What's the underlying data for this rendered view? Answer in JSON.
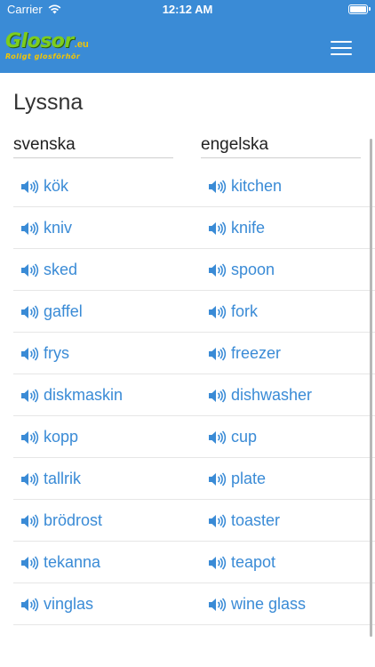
{
  "status": {
    "carrier": "Carrier",
    "time": "12:12 AM"
  },
  "header": {
    "logo_main": "Glosor",
    "logo_tld": ".eu",
    "logo_tagline": "Roligt glosförhör"
  },
  "page": {
    "title": "Lyssna"
  },
  "columns": {
    "left": "svenska",
    "right": "engelska"
  },
  "words": [
    {
      "sv": "kök",
      "en": "kitchen"
    },
    {
      "sv": "kniv",
      "en": "knife"
    },
    {
      "sv": "sked",
      "en": "spoon"
    },
    {
      "sv": "gaffel",
      "en": "fork"
    },
    {
      "sv": "frys",
      "en": "freezer"
    },
    {
      "sv": "diskmaskin",
      "en": "dishwasher"
    },
    {
      "sv": "kopp",
      "en": "cup"
    },
    {
      "sv": "tallrik",
      "en": "plate"
    },
    {
      "sv": "brödrost",
      "en": "toaster"
    },
    {
      "sv": "tekanna",
      "en": "teapot"
    },
    {
      "sv": "vinglas",
      "en": "wine glass"
    }
  ]
}
